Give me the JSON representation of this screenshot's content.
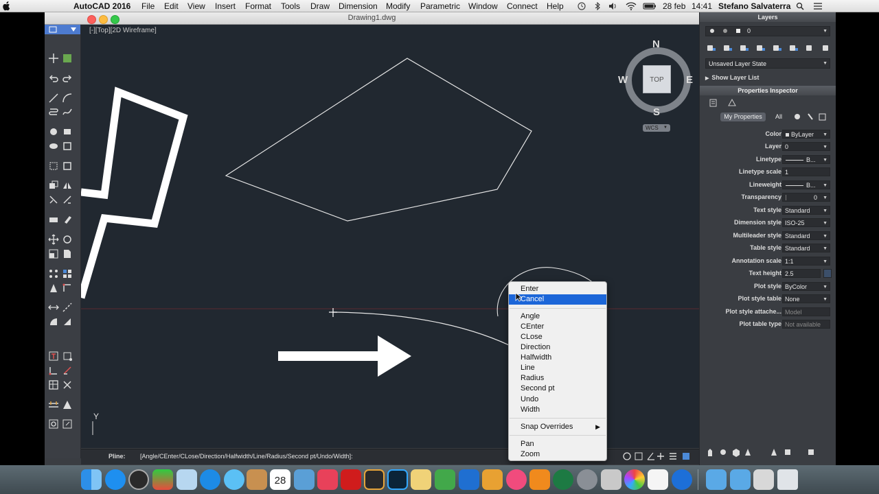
{
  "menubar": {
    "app_name": "AutoCAD 2016",
    "menus": [
      "File",
      "Edit",
      "View",
      "Insert",
      "Format",
      "Tools",
      "Draw",
      "Dimension",
      "Modify",
      "Parametric",
      "Window",
      "Connect",
      "Help"
    ],
    "date": "28 feb",
    "time": "14:41",
    "user": "Stefano Salvaterra"
  },
  "window": {
    "title": "Drawing1.dwg",
    "viewport_label": "[-][Top][2D Wireframe]",
    "viewcube": {
      "north": "N",
      "south": "S",
      "east": "E",
      "west": "W",
      "face": "TOP",
      "wcs": "WCS"
    },
    "ucs_y_label": "Y"
  },
  "command_line": {
    "prompt": "Pline:",
    "text": "[Angle/CEnter/CLose/Direction/Halfwidth/Line/Radius/Second pt/Undo/Width]:"
  },
  "layers_panel": {
    "title": "Layers",
    "current_layer": "0",
    "layer_state": "Unsaved Layer State",
    "show_layer_list": "Show Layer List"
  },
  "properties_panel": {
    "title": "Properties Inspector",
    "tab_my": "My Properties",
    "tab_all": "All",
    "rows": [
      {
        "label": "Color",
        "value": "ByLayer"
      },
      {
        "label": "Layer",
        "value": "0"
      },
      {
        "label": "Linetype",
        "value": "B..."
      },
      {
        "label": "Linetype scale",
        "value": "1"
      },
      {
        "label": "Lineweight",
        "value": "B..."
      },
      {
        "label": "Transparency",
        "value": "0"
      },
      {
        "label": "Text style",
        "value": "Standard"
      },
      {
        "label": "Dimension style",
        "value": "ISO-25"
      },
      {
        "label": "Multileader style",
        "value": "Standard"
      },
      {
        "label": "Table style",
        "value": "Standard"
      },
      {
        "label": "Annotation scale",
        "value": "1:1"
      },
      {
        "label": "Text height",
        "value": "2.5"
      },
      {
        "label": "Plot style",
        "value": "ByColor"
      },
      {
        "label": "Plot style table",
        "value": "None"
      },
      {
        "label": "Plot style attache...",
        "value": "Model"
      },
      {
        "label": "Plot table type",
        "value": "Not available"
      }
    ]
  },
  "context_menu": {
    "items": [
      "Enter",
      "Cancel",
      "Angle",
      "CEnter",
      "CLose",
      "Direction",
      "Halfwidth",
      "Line",
      "Radius",
      "Second pt",
      "Undo",
      "Width",
      "Snap Overrides",
      "Pan",
      "Zoom"
    ],
    "selected": "Cancel"
  },
  "dock": {
    "calendar_day": "28"
  }
}
